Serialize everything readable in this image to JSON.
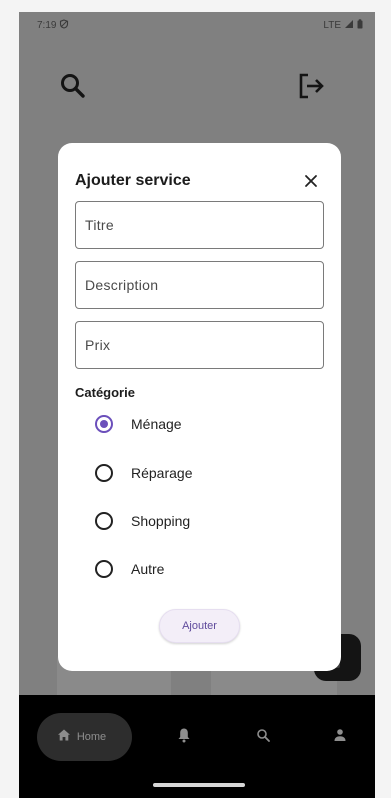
{
  "status_bar": {
    "time": "7:19",
    "network": "LTE"
  },
  "colors": {
    "accent": "#6b4fbb",
    "scrim": "#808080",
    "nav_background": "#000000",
    "dialog_background": "#ffffff",
    "button_background": "#f3eef8"
  },
  "icons": {
    "top_left": "search-icon",
    "top_right": "logout-icon",
    "close": "close-icon",
    "nav_home": "home-icon",
    "nav_notifications": "bell-icon",
    "nav_search": "search-icon",
    "nav_profile": "person-icon"
  },
  "dialog": {
    "title": "Ajouter service",
    "fields": {
      "titre": {
        "placeholder": "Titre",
        "value": ""
      },
      "description": {
        "placeholder": "Description",
        "value": ""
      },
      "prix": {
        "placeholder": "Prix",
        "value": ""
      }
    },
    "category_label": "Catégorie",
    "categories": [
      {
        "label": "Ménage",
        "selected": true
      },
      {
        "label": "Réparage",
        "selected": false
      },
      {
        "label": "Shopping",
        "selected": false
      },
      {
        "label": "Autre",
        "selected": false
      }
    ],
    "submit_label": "Ajouter"
  },
  "bottom_nav": {
    "items": [
      {
        "label": "Home",
        "icon": "home-icon",
        "active": true
      },
      {
        "label": "",
        "icon": "bell-icon",
        "active": false
      },
      {
        "label": "",
        "icon": "search-icon",
        "active": false
      },
      {
        "label": "",
        "icon": "person-icon",
        "active": false
      }
    ]
  }
}
